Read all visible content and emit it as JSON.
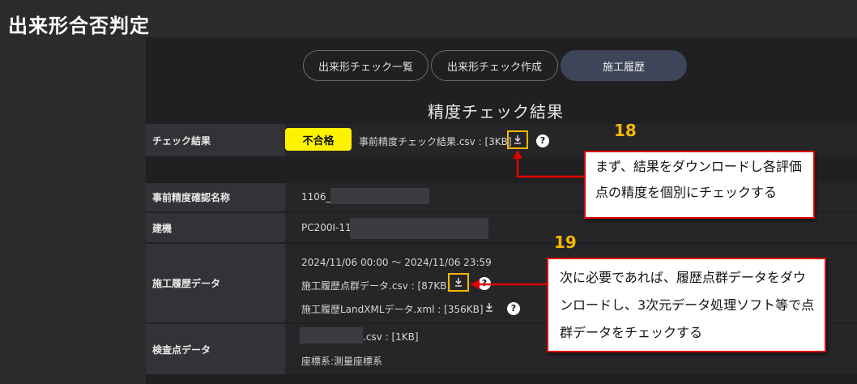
{
  "page": {
    "title": "出来形合否判定"
  },
  "tabs": [
    {
      "label": "出来形チェック一覧",
      "active": false
    },
    {
      "label": "出来形チェック作成",
      "active": false
    },
    {
      "label": "施工履歴",
      "active": true
    }
  ],
  "section_title": "精度チェック結果",
  "check_result": {
    "label": "チェック結果",
    "badge": "不合格",
    "file": "事前精度チェック結果.csv : [3KB]",
    "help": "?"
  },
  "precision_name": {
    "label": "事前精度確認名称",
    "value": "1106_"
  },
  "machine": {
    "label": "建機",
    "value": "PC200I-11"
  },
  "history_data": {
    "label": "施工履歴データ",
    "range": "2024/11/06 00:00 ～ 2024/11/06 23:59",
    "point_file": "施工履歴点群データ.csv : [87KB]",
    "xml_file": "施工履歴LandXMLデータ.xml : [356KB]",
    "help": "?"
  },
  "inspection_data": {
    "label": "検査点データ",
    "file": ".csv : [1KB]",
    "coord": "座標系:測量座標系"
  },
  "annotations": {
    "step1_number": "18",
    "step1_line1": "まず、結果をダウンロードし各評価",
    "step1_line2": "点の精度を個別にチェックする",
    "step2_number": "19",
    "step2_line1": "次に必要であれば、履歴点群データをダウ",
    "step2_line2": "ンロードし、3次元データ処理ソフト等で点",
    "step2_line3": "群データをチェックする"
  },
  "colors": {
    "background": "#2b2b2e",
    "accent_yellow": "#fff200",
    "highlight": "#f5b800",
    "callout_border": "#e00000",
    "active_tab": "#3e4559"
  },
  "icons": {
    "download": "download-icon",
    "help": "help-circle-icon"
  }
}
